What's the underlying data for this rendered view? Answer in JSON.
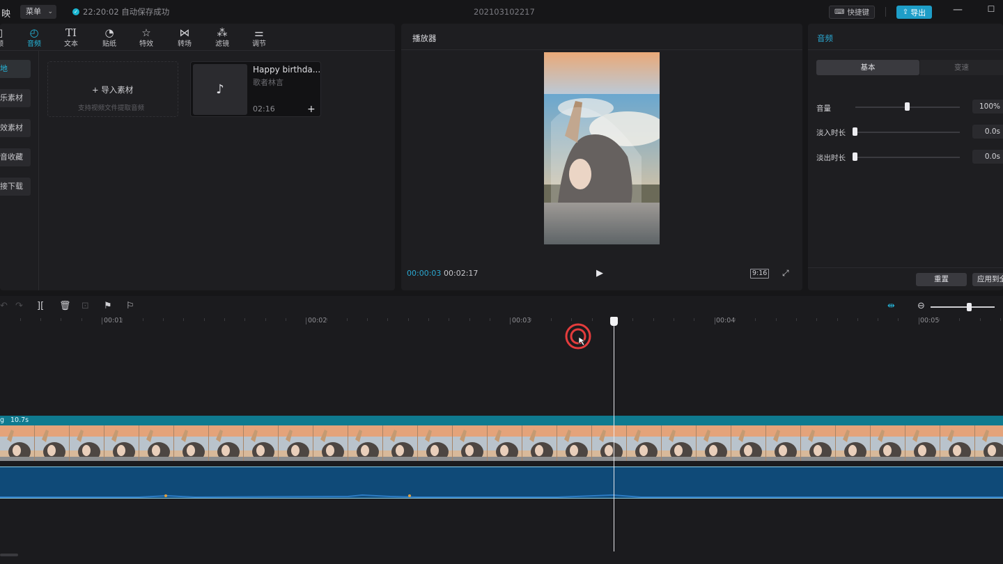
{
  "titlebar": {
    "app_name": "映",
    "menu_label": "菜单",
    "save_status": "22:20:02 自动保存成功",
    "project_name": "202103102217",
    "shortcut_label": "快捷键",
    "export_label": "导出"
  },
  "media_toolbar": {
    "tools": [
      {
        "label": "频",
        "icon": "video-icon"
      },
      {
        "label": "音频",
        "icon": "audio-icon"
      },
      {
        "label": "文本",
        "icon": "text-icon"
      },
      {
        "label": "贴纸",
        "icon": "sticker-icon"
      },
      {
        "label": "特效",
        "icon": "effects-icon"
      },
      {
        "label": "转场",
        "icon": "transition-icon"
      },
      {
        "label": "滤镜",
        "icon": "filter-icon"
      },
      {
        "label": "调节",
        "icon": "adjust-icon"
      }
    ]
  },
  "categories": [
    "地",
    "乐素材",
    "效素材",
    "音收藏",
    "接下载"
  ],
  "import_card": {
    "title": "导入素材",
    "subtitle": "支持视频文件提取音频"
  },
  "audio_card": {
    "title": "Happy birthda...",
    "artist": "歌者林言",
    "duration": "02:16"
  },
  "player": {
    "title": "播放器",
    "current_time": "00:00:03",
    "total_time": "00:02:17",
    "ratio": "9:16"
  },
  "props": {
    "title": "音频",
    "tabs": [
      "基本",
      "变速"
    ],
    "rows": [
      {
        "label": "音量",
        "value": "100%",
        "level": 0.5
      },
      {
        "label": "淡入时长",
        "value": "0.0s",
        "level": 0.0
      },
      {
        "label": "淡出时长",
        "value": "0.0s",
        "level": 0.0
      }
    ],
    "reset_label": "重置",
    "apply_label": "应用到全部"
  },
  "timeline": {
    "ticks": [
      "00:01",
      "00:02",
      "00:03",
      "00:04",
      "00:05"
    ],
    "clip_name": "g",
    "clip_duration": "10.7s",
    "zoom_level": 0.6
  },
  "colors": {
    "accent": "#25b4d8",
    "export": "#1e9ec8",
    "video_track": "#0f7a8f",
    "audio_track": "#0f4a78"
  }
}
